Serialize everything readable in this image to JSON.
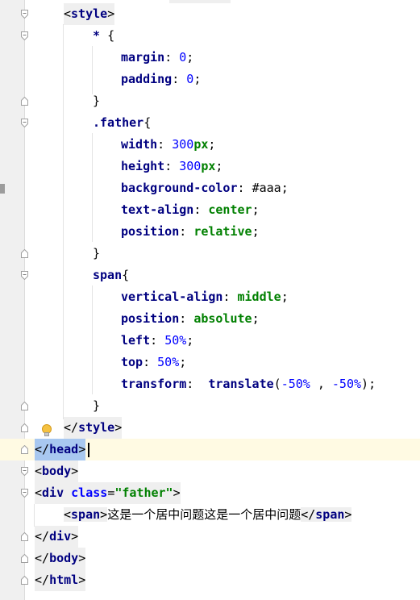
{
  "editor": {
    "lines": {
      "style_open": {
        "open": "<",
        "name": "style",
        "close": ">"
      },
      "star": {
        "selector": "*",
        "brace": "{"
      },
      "margin": {
        "prop": "margin",
        "colon": ":",
        "value": "0",
        "semi": ";"
      },
      "padding": {
        "prop": "padding",
        "colon": ":",
        "value": "0",
        "semi": ";"
      },
      "brace1": {
        "brace": "}"
      },
      "father": {
        "selector": ".father",
        "brace": "{"
      },
      "width": {
        "prop": "width",
        "colon": ":",
        "num": "300",
        "unit": "px",
        "semi": ";"
      },
      "height": {
        "prop": "height",
        "colon": ":",
        "num": "300",
        "unit": "px",
        "semi": ";"
      },
      "bg": {
        "prop": "background-color",
        "colon": ":",
        "value": "#aaa",
        "semi": ";"
      },
      "textalign": {
        "prop": "text-align",
        "colon": ":",
        "kw": "center",
        "semi": ";"
      },
      "position1": {
        "prop": "position",
        "colon": ":",
        "kw": "relative",
        "semi": ";"
      },
      "brace2": {
        "brace": "}"
      },
      "span_sel": {
        "selector": "span",
        "brace": "{"
      },
      "valign": {
        "prop": "vertical-align",
        "colon": ":",
        "kw": "middle",
        "semi": ";"
      },
      "position2": {
        "prop": "position",
        "colon": ":",
        "kw": "absolute",
        "semi": ";"
      },
      "left": {
        "prop": "left",
        "colon": ":",
        "num": "50%",
        "semi": ";"
      },
      "top": {
        "prop": "top",
        "colon": ":",
        "num": "50%",
        "semi": ";"
      },
      "transform": {
        "prop": "transform",
        "colon": ":",
        "fn": "translate",
        "paren_open": "(",
        "num1": "-50%",
        "comma": " , ",
        "num2": "-50%",
        "paren_close": ")",
        "semi": ";"
      },
      "brace3": {
        "brace": "}"
      },
      "style_close": {
        "open": "</",
        "name": "style",
        "close": ">"
      },
      "head_close": {
        "open": "</",
        "name": "head",
        "close": ">"
      },
      "body_open": {
        "open": "<",
        "name": "body",
        "close": ">"
      },
      "div_open": {
        "open": "<",
        "name": "div",
        "attr": "class",
        "eq": "=",
        "val": "\"father\"",
        "close": ">"
      },
      "span_line": {
        "open": "<",
        "name": "span",
        "close": ">",
        "text": "这是一个居中问题这是一个居中问题",
        "end_open": "</",
        "end_name": "span",
        "end_close": ">"
      },
      "div_close": {
        "open": "</",
        "name": "div",
        "close": ">"
      },
      "body_close": {
        "open": "</",
        "name": "body",
        "close": ">"
      },
      "html_close": {
        "open": "</",
        "name": "html",
        "close": ">"
      }
    },
    "icons": [
      "fold-marker-icon",
      "lightbulb-icon"
    ],
    "colors": {
      "tag": "#000080",
      "attribute": "#0000ff",
      "string": "#008000",
      "number": "#0000ff",
      "keyword": "#008000",
      "current_line": "#fffae3",
      "selection": "#a8c8f0",
      "gutter": "#f0f0f0"
    }
  }
}
